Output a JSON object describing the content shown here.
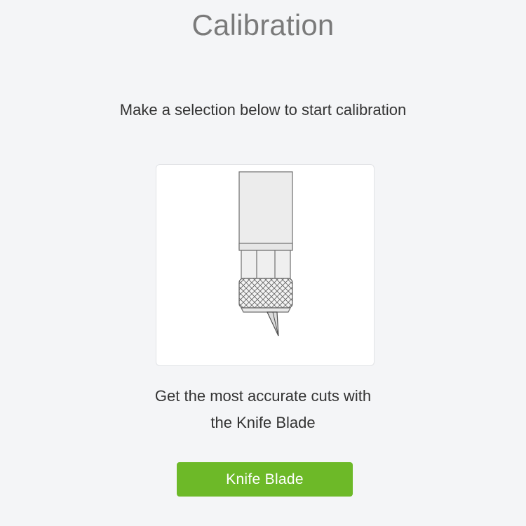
{
  "header": {
    "title": "Calibration"
  },
  "main": {
    "instruction": "Make a selection below to start calibration",
    "option": {
      "icon": "knife-blade-icon",
      "description_line1": "Get the most accurate cuts with",
      "description_line2": "the Knife Blade",
      "button_label": "Knife Blade"
    }
  },
  "colors": {
    "background": "#f4f5f7",
    "button": "#6db928",
    "button_text": "#ffffff",
    "title": "#7a7a7a"
  }
}
